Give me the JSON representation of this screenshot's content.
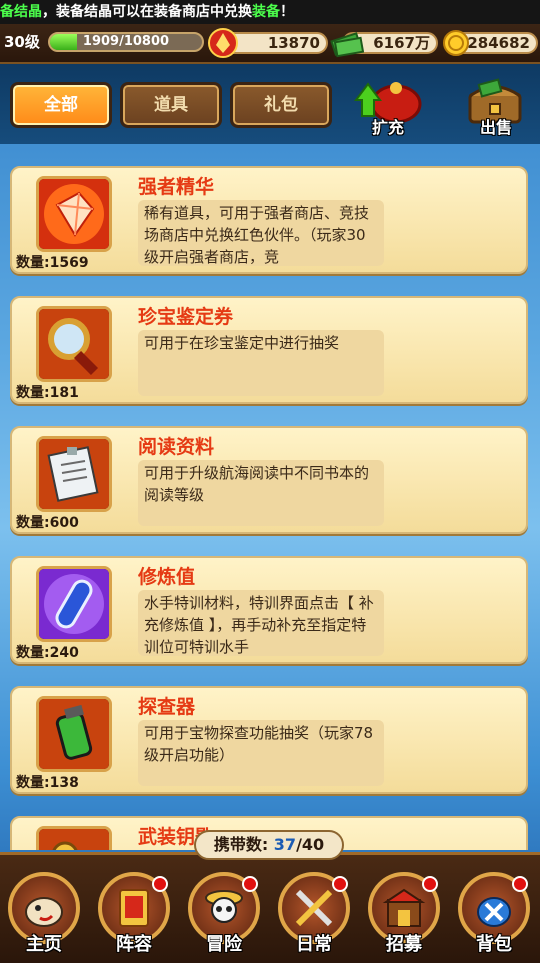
{
  "marquee": {
    "prefix": "备结晶",
    "middle": "，装备结晶可以在装备商店中兑换",
    "highlight": "装备",
    "suffix": "！"
  },
  "status": {
    "level": "30级",
    "exp": "1909/10800",
    "exp_fraction": 0.177,
    "power": "13870",
    "cash": "6167万",
    "gold": "284682"
  },
  "tabs": [
    {
      "label": "全部",
      "active": true
    },
    {
      "label": "道具",
      "active": false
    },
    {
      "label": "礼包",
      "active": false
    }
  ],
  "actions": {
    "expand": "扩充",
    "sell": "出售"
  },
  "items": [
    {
      "name": "强者精华",
      "desc": "稀有道具，可用于强者商店、竞技场商店中兑换红色伙伴。（玩家30级开启强者商店，竞",
      "qty": "数量:1569",
      "icon": "crystal-icon"
    },
    {
      "name": "珍宝鉴定券",
      "desc": "可用于在珍宝鉴定中进行抽奖",
      "qty": "数量:181",
      "icon": "magnifier-icon"
    },
    {
      "name": "阅读资料",
      "desc": "可用于升级航海阅读中不同书本的阅读等级",
      "qty": "数量:600",
      "icon": "document-icon"
    },
    {
      "name": "修炼值",
      "desc": "水手特训材料，特训界面点击【 补充修炼值 】，再手动补充至指定特训位可特训水手",
      "qty": "数量:240",
      "icon": "capsule-icon"
    },
    {
      "name": "探查器",
      "desc": "可用于宝物探查功能抽奖（玩家78级开启功能）",
      "qty": "数量:138",
      "icon": "detector-icon"
    },
    {
      "name": "武装钥匙",
      "desc": "",
      "qty": "",
      "icon": "key-icon"
    }
  ],
  "capacity": {
    "label": "携带数:",
    "current": "37",
    "sep": "/",
    "max": "40"
  },
  "nav": [
    {
      "label": "主页",
      "dot": false,
      "icon": "home-icon"
    },
    {
      "label": "阵容",
      "dot": true,
      "icon": "lineup-icon"
    },
    {
      "label": "冒险",
      "dot": true,
      "icon": "skull-icon"
    },
    {
      "label": "日常",
      "dot": true,
      "icon": "swords-icon"
    },
    {
      "label": "招募",
      "dot": true,
      "icon": "tavern-icon"
    },
    {
      "label": "背包",
      "dot": true,
      "icon": "bag-icon"
    }
  ],
  "colors": {
    "accent": "#ff9a1f",
    "item_name": "#e53a14",
    "capacity_num": "#1a5bb4"
  }
}
